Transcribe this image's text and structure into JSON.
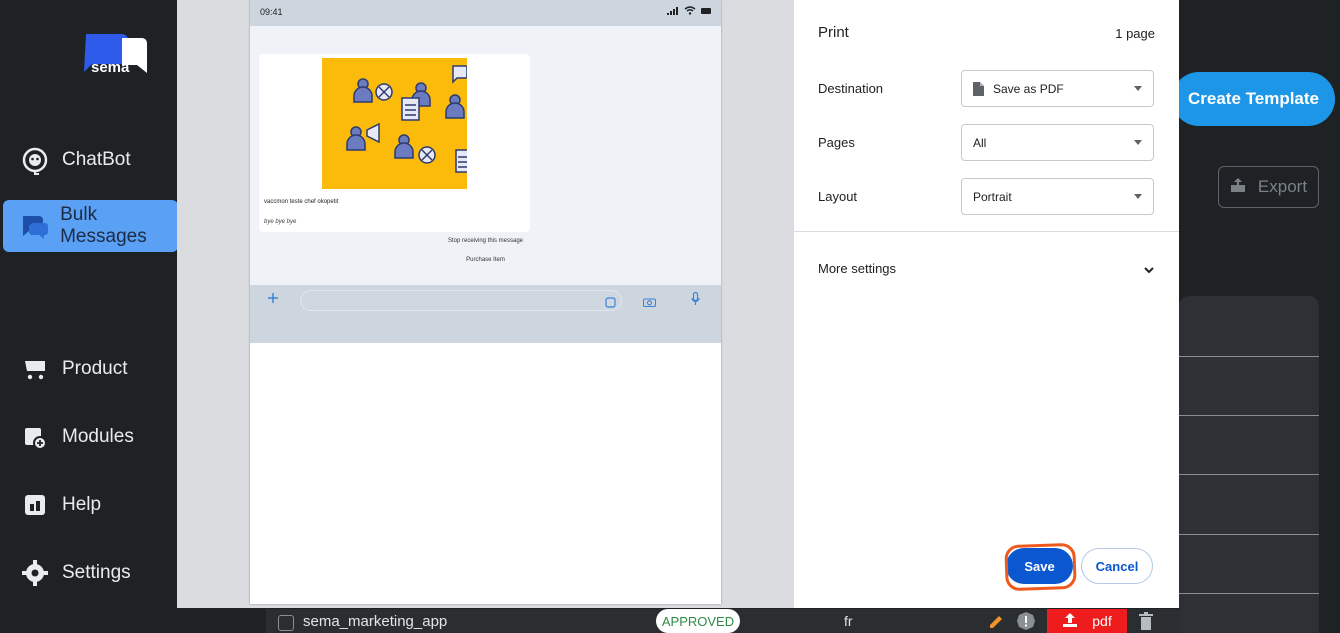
{
  "sidebar": {
    "logo_text": "sema",
    "items": [
      {
        "label": "ChatBot",
        "icon": "chatbot-icon"
      },
      {
        "label": "Bulk Messages",
        "icon": "chat-bubbles-icon",
        "active": true
      },
      {
        "label": "Product",
        "icon": "cart-icon"
      },
      {
        "label": "Modules",
        "icon": "calendar-plus-icon"
      },
      {
        "label": "Help",
        "icon": "help-icon"
      },
      {
        "label": "Settings",
        "icon": "gear-icon"
      }
    ]
  },
  "header": {
    "create_template_label": "Create Template",
    "export_label": "Export"
  },
  "table": {
    "row": {
      "name": "sema_marketing_app",
      "status": "APPROVED",
      "language": "fr",
      "pdf_label": "pdf"
    }
  },
  "print_dialog": {
    "title": "Print",
    "page_count": "1 page",
    "destination_label": "Destination",
    "destination_value": "Save as PDF",
    "pages_label": "Pages",
    "pages_value": "All",
    "layout_label": "Layout",
    "layout_value": "Portrait",
    "more_settings_label": "More settings",
    "save_label": "Save",
    "cancel_label": "Cancel",
    "preview": {
      "status_time": "09:41",
      "message_text": "vaccmon teste chef okopetit",
      "message_footer": "bye bye bye",
      "button_1": "Stop receiving this message",
      "button_2": "Purchase Item"
    }
  },
  "colors": {
    "accent_blue": "#1e96e8",
    "active_nav": "#5aa0f5",
    "save_blue": "#0b57d0",
    "highlight_orange": "#ee5a1e",
    "pdf_red": "#ee1c1c",
    "image_yellow": "#fcba0a"
  }
}
